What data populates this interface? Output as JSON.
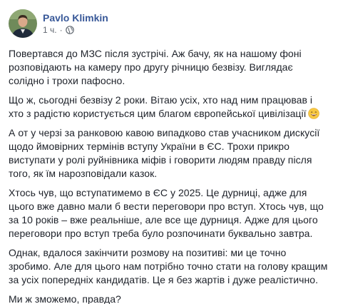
{
  "post": {
    "author": "Pavlo Klimkin",
    "time": "1 ч.",
    "separator": "·",
    "privacy_icon": "globe-icon",
    "accent_color": "#385898",
    "paragraphs": [
      "Повертався до МЗС після зустрічі. Аж бачу, як на нашому фоні розповідають на камеру про другу річницю безвізу. Виглядає солідно і трохи пафосно.",
      "Що ж, сьогодні безвізу 2 роки. Вітаю усіх, хто над ним працював і хто з радістю користується цим благом європейської цивілізації",
      "А от у черзі за ранковою кавою випадково став учасником дискусії щодо ймовірних термінів вступу України в ЄС. Трохи прикро виступати у ролі руйнівника міфів і говорити людям правду після того, як їм нарозповідали казок.",
      "Хтось чув, що вступатимемо в ЄС у 2025. Це дурниці, адже для цього вже давно мали б вести переговори про вступ. Хтось чув, що за 10 років – вже реальніше, але все ще дурниця. Адже для цього переговори про вступ треба було розпочинати буквально завтра.",
      "Однак, вдалося закінчити розмову на позитиві: ми це точно зробимо. Але для цього нам потрібно точно стати на голову кращим за усіх попередніх кандидатів. Це я без жартів і дуже реалістично.",
      "Ми ж зможемо, правда?"
    ],
    "emoji_icon": "smile-emoji-icon"
  }
}
